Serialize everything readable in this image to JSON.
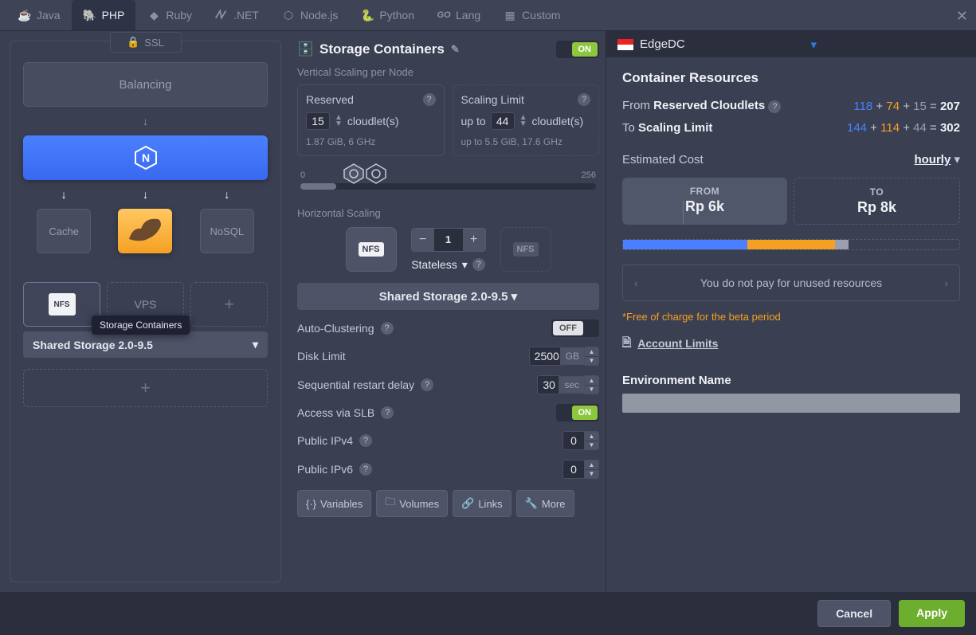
{
  "tabs": [
    {
      "label": "Java"
    },
    {
      "label": "PHP"
    },
    {
      "label": "Ruby"
    },
    {
      "label": ".NET"
    },
    {
      "label": "Node.js"
    },
    {
      "label": "Python"
    },
    {
      "label": "Lang"
    },
    {
      "label": "Custom"
    }
  ],
  "topology": {
    "ssl": "SSL",
    "balancing": "Balancing",
    "cache": "Cache",
    "nosql": "NoSQL",
    "nfs": "NFS",
    "vps": "VPS",
    "tooltip": "Storage Containers",
    "shared_bar": "Shared Storage 2.0-9.5"
  },
  "center": {
    "title": "Storage Containers",
    "on": "ON",
    "off": "OFF",
    "vs_label": "Vertical Scaling per Node",
    "reserved": {
      "title": "Reserved",
      "value": "15",
      "unit": "cloudlet(s)",
      "sub": "1.87 GiB, 6 GHz"
    },
    "limit": {
      "title": "Scaling Limit",
      "prefix": "up to",
      "value": "44",
      "unit": "cloudlet(s)",
      "sub_prefix": "up to",
      "sub": "5.5 GiB, 17.6 GHz"
    },
    "slider_min": "0",
    "slider_max": "256",
    "hs_label": "Horizontal Scaling",
    "qty": "1",
    "stateless": "Stateless",
    "nfs": "NFS",
    "dropdown": "Shared Storage 2.0-9.5",
    "auto_cluster": "Auto-Clustering",
    "disk_limit": {
      "label": "Disk Limit",
      "value": "2500",
      "unit": "GB"
    },
    "restart_delay": {
      "label": "Sequential restart delay",
      "value": "30",
      "unit": "sec"
    },
    "slb": "Access via SLB",
    "ipv4": {
      "label": "Public IPv4",
      "value": "0"
    },
    "ipv6": {
      "label": "Public IPv6",
      "value": "0"
    },
    "buttons": {
      "variables": "Variables",
      "volumes": "Volumes",
      "links": "Links",
      "more": "More"
    }
  },
  "right": {
    "region": "EdgeDC",
    "title": "Container Resources",
    "from_row": {
      "prefix": "From",
      "label": "Reserved Cloudlets",
      "a": "118",
      "b": "74",
      "c": "15",
      "total": "207"
    },
    "to_row": {
      "prefix": "To",
      "label": "Scaling Limit",
      "a": "144",
      "b": "114",
      "c": "44",
      "total": "302"
    },
    "est_label": "Estimated Cost",
    "period": "hourly",
    "price_from": {
      "label": "FROM",
      "value": "Rp 6k"
    },
    "price_to": {
      "label": "TO",
      "value": "Rp 8k"
    },
    "note": "You do not pay for unused resources",
    "free": "*Free of charge for the beta period",
    "account_limits": "Account Limits",
    "env_label": "Environment Name"
  },
  "footer": {
    "cancel": "Cancel",
    "apply": "Apply"
  }
}
